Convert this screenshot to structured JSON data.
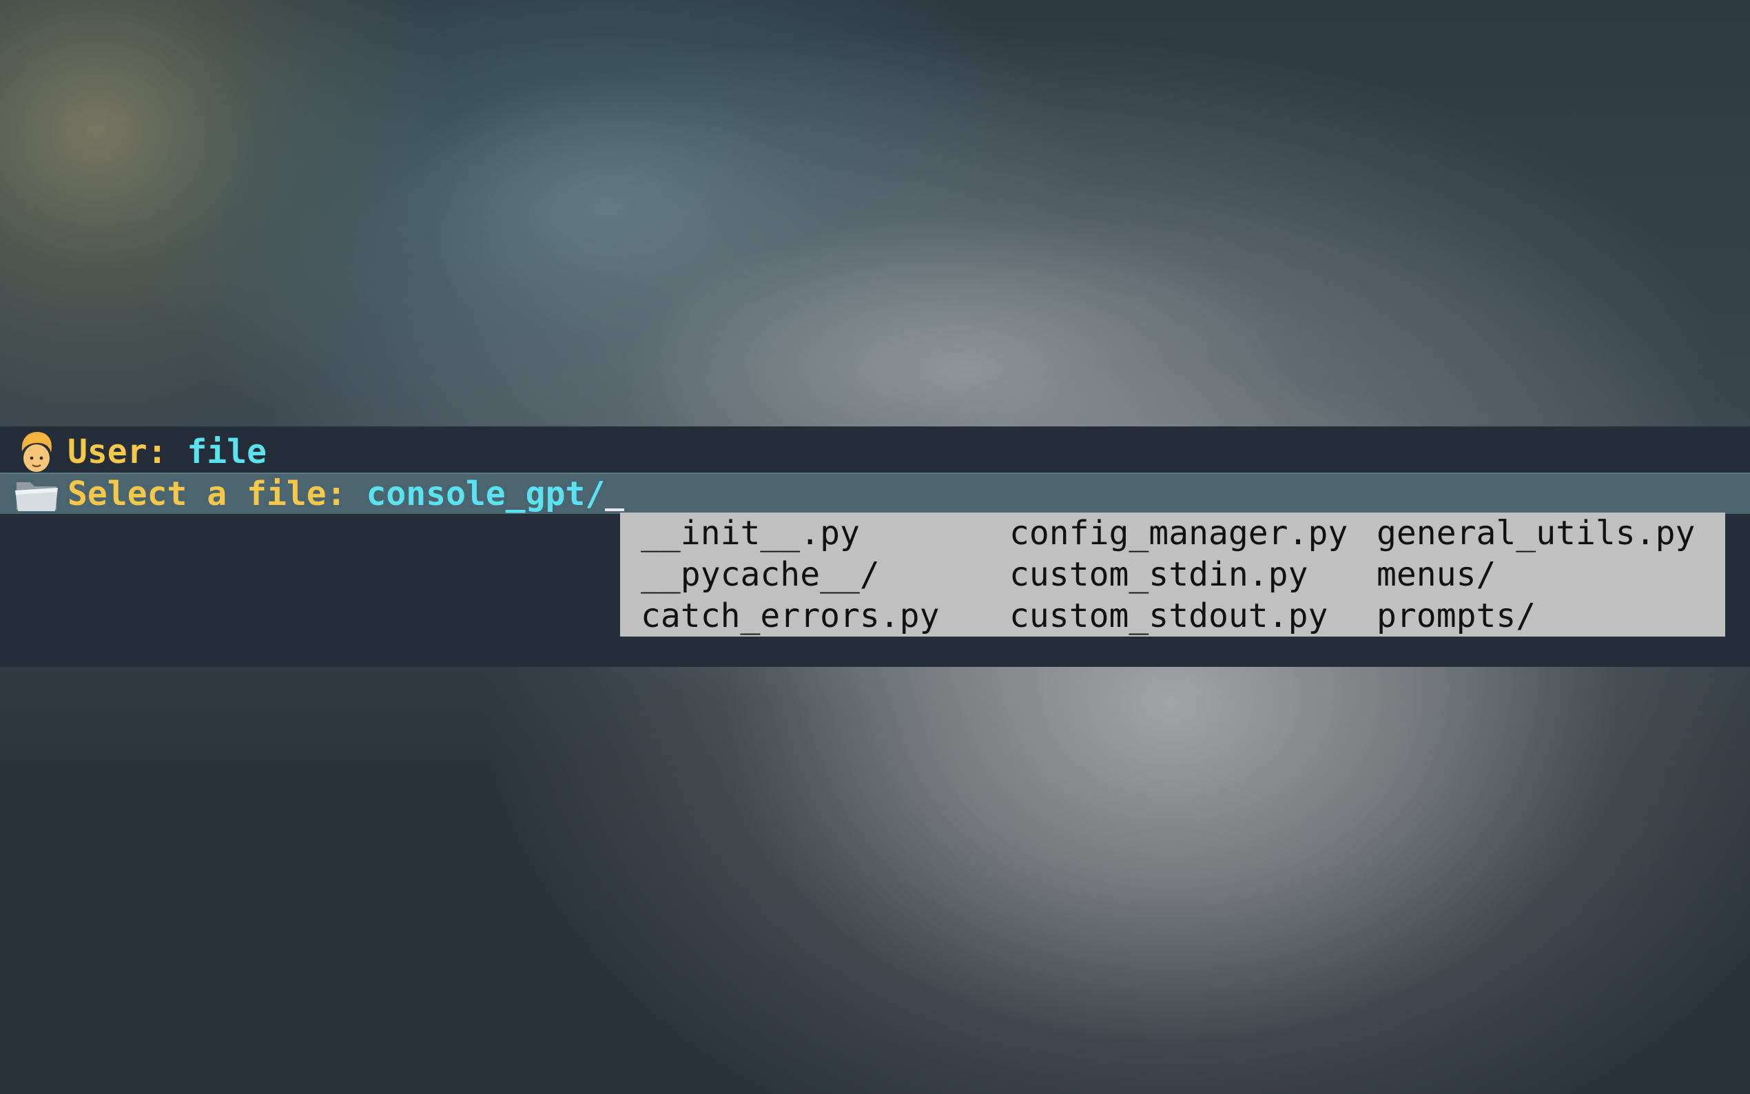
{
  "user_line": {
    "avatar_icon": "person-emoji-icon",
    "prompt": "User: ",
    "value": "file"
  },
  "select_line": {
    "folder_icon": "folder-icon",
    "prompt": "Select a file: ",
    "value": "console_gpt/"
  },
  "completion_menu": {
    "items": [
      "__init__.py",
      "__pycache__/",
      "catch_errors.py",
      "config_manager.py",
      "custom_stdin.py",
      "custom_stdout.py",
      "general_utils.py",
      "menus/",
      "prompts/"
    ]
  },
  "colors": {
    "prompt": "#f5c84a",
    "value": "#5ae3ef",
    "band": "#252e38",
    "highlight": "#4a6570",
    "menu_bg": "#c0c0c0"
  }
}
